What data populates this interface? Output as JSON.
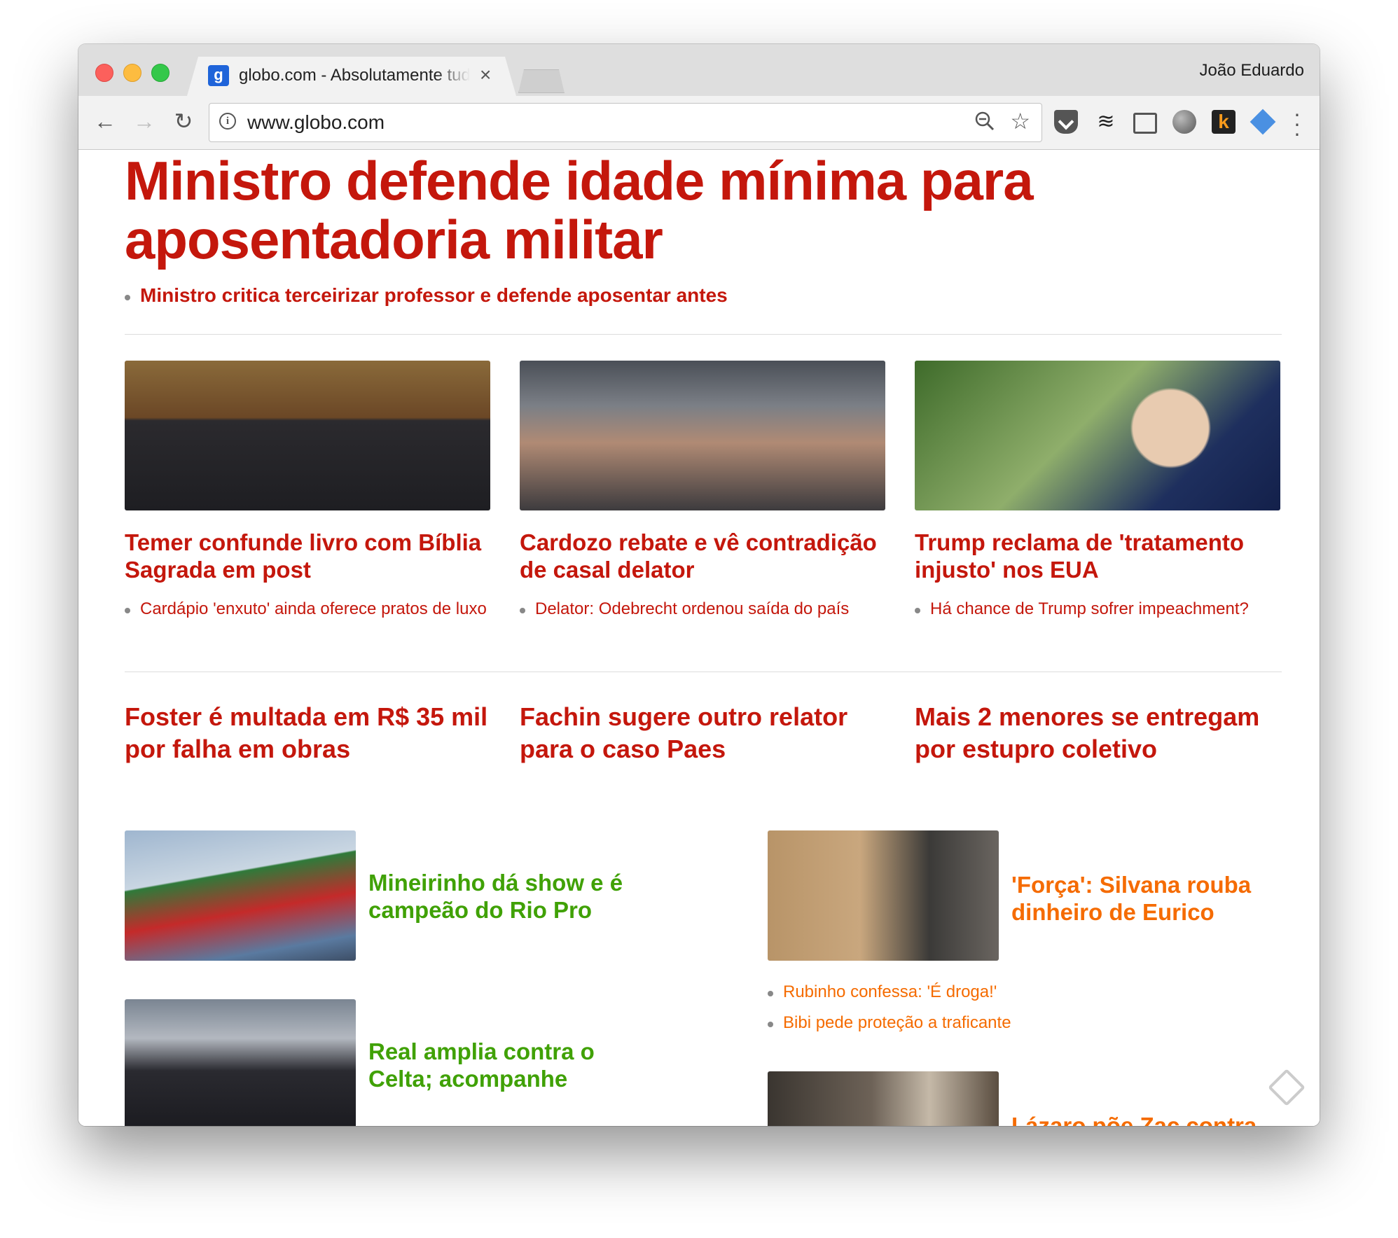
{
  "browser": {
    "tab_favicon": "g",
    "tab_title": "globo.com - Absolutamente tudo",
    "tab_close": "×",
    "profile_name": "João Eduardo",
    "url": "www.globo.com",
    "icons": [
      "back-arrow-icon",
      "forward-arrow-icon",
      "reload-icon",
      "info-icon",
      "zoom-icon",
      "star-icon",
      "pocket-icon",
      "buffer-icon",
      "cast-icon",
      "sphere-icon",
      "k-extension-icon",
      "diamond-extension-icon",
      "menu-icon"
    ]
  },
  "main_story": {
    "headline": "Ministro defende idade mínima para aposentadoria militar",
    "sub": "Ministro critica terceirizar professor e defende aposentar antes"
  },
  "featured": [
    {
      "title": "Temer confunde livro com Bíblia Sagrada em post",
      "sub": "Cardápio 'enxuto' ainda oferece pratos de luxo"
    },
    {
      "title": "Cardozo rebate e vê contradição de casal delator",
      "sub": "Delator: Odebrecht ordenou saída do país"
    },
    {
      "title": "Trump reclama de 'tratamento injusto' nos EUA",
      "sub": "Há chance de Trump sofrer impeachment?"
    }
  ],
  "text_stories": [
    "Foster é multada em R$ 35 mil por falha em obras",
    "Fachin sugere outro relator para o caso Paes",
    "Mais 2 menores se entregam por estupro coletivo"
  ],
  "sports": [
    {
      "title": "Mineirinho dá show e é campeão do Rio Pro"
    },
    {
      "title": "Real amplia contra o Celta; acompanhe"
    }
  ],
  "entertainment": [
    {
      "title": "'Força': Silvana rouba dinheiro de Eurico",
      "subs": [
        "Rubinho confessa: 'É droga!'",
        "Bibi pede proteção a traficante"
      ]
    },
    {
      "title": "Lázaro põe Zac contra"
    }
  ],
  "colors": {
    "news": "#c4170c",
    "sports": "#40a106",
    "entertainment": "#f56b00"
  }
}
